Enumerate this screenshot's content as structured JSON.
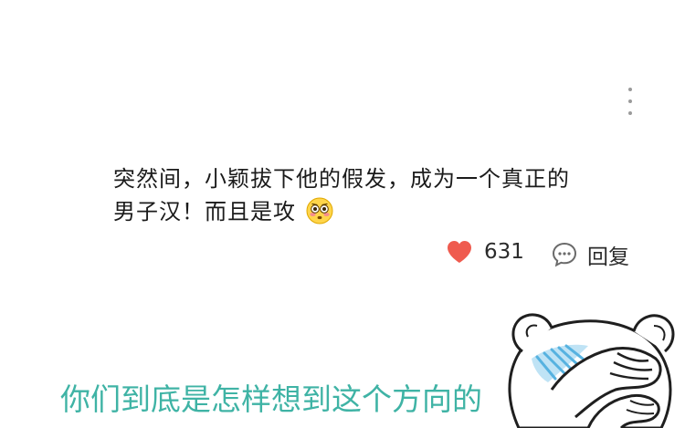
{
  "comment": {
    "line1": "突然间，小颖拔下他的假发，成为一个真正的",
    "line2": "男子汉！而且是攻",
    "emoji_icon": "flushed-face-emoji"
  },
  "actions": {
    "like_count": "631",
    "reply_label": "回复",
    "like_icon": "heart-icon",
    "reply_icon": "speech-bubble-icon",
    "menu_icon": "more-vertical-icon"
  },
  "caption": {
    "text": "你们到底是怎样想到这个方向的"
  },
  "meme": {
    "icon": "bear-covering-eyes-meme"
  },
  "colors": {
    "heart": "#ef5b4f",
    "caption": "#3fb3a5",
    "text": "#1b1b1b"
  }
}
